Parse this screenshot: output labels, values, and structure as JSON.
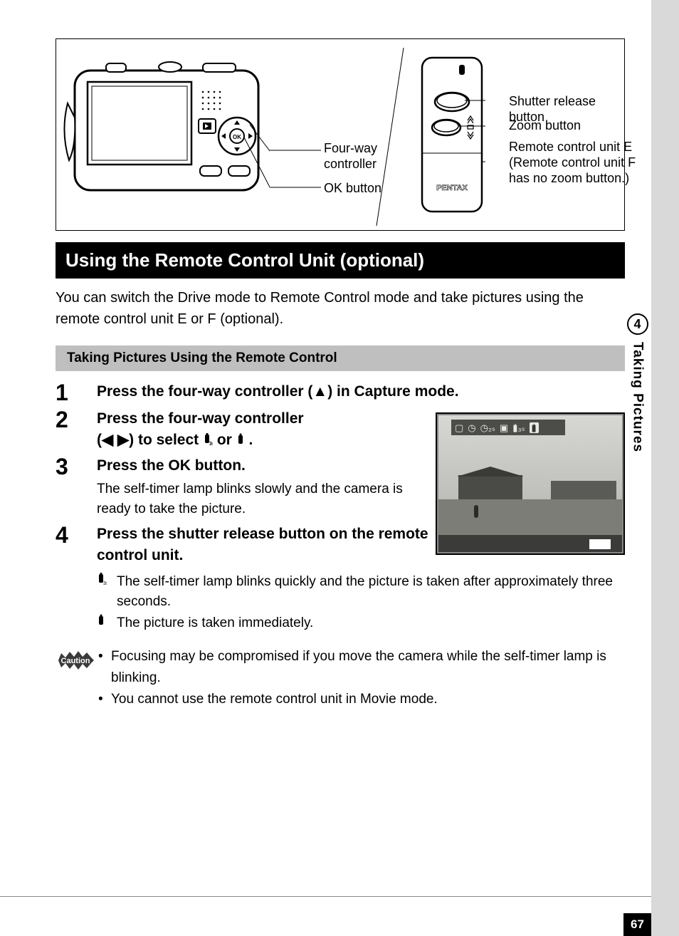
{
  "diagram": {
    "labels": {
      "fourway": "Four-way controller",
      "ok": "OK button",
      "shutter": "Shutter release button",
      "zoom": "Zoom button",
      "remote": "Remote control unit E (Remote control unit F has no zoom button.)",
      "brand": "PENTAX"
    }
  },
  "titleBar": "Using the Remote Control Unit (optional)",
  "intro": "You can switch the Drive mode to Remote Control mode and take pictures using the remote control unit E or F (optional).",
  "grayBar": "Taking Pictures Using the Remote Control",
  "steps": {
    "s1": {
      "num": "1",
      "head": "Press the four-way controller (▲) in Capture mode."
    },
    "s2": {
      "num": "2",
      "head_a": "Press the four-way controller",
      "head_b": "(◀ ▶) to select ",
      "head_c": " or ",
      "head_d": " ."
    },
    "s3": {
      "num": "3",
      "head": "Press the OK button.",
      "sub": "The self-timer lamp blinks slowly and the camera is ready to take the picture."
    },
    "s4": {
      "num": "4",
      "head": "Press the shutter release button on the remote control unit."
    }
  },
  "results": {
    "r1": "The self-timer lamp blinks quickly and the picture is taken after approximately three seconds.",
    "r2": "The picture is taken immediately."
  },
  "caution": {
    "label": "Caution",
    "b1": "Focusing may be compromised if you move the camera while the self-timer lamp is blinking.",
    "b2": "You cannot use the remote control unit in Movie mode."
  },
  "sideTab": {
    "chapter": "4",
    "title": "Taking Pictures"
  },
  "pageNumber": "67",
  "iconStrip": {
    "i1": "▢",
    "i2": "◷",
    "i3": "◷₂ₛ",
    "i4": "▣",
    "i5": "▮̇₃ₛ",
    "i6": "▮̇"
  }
}
